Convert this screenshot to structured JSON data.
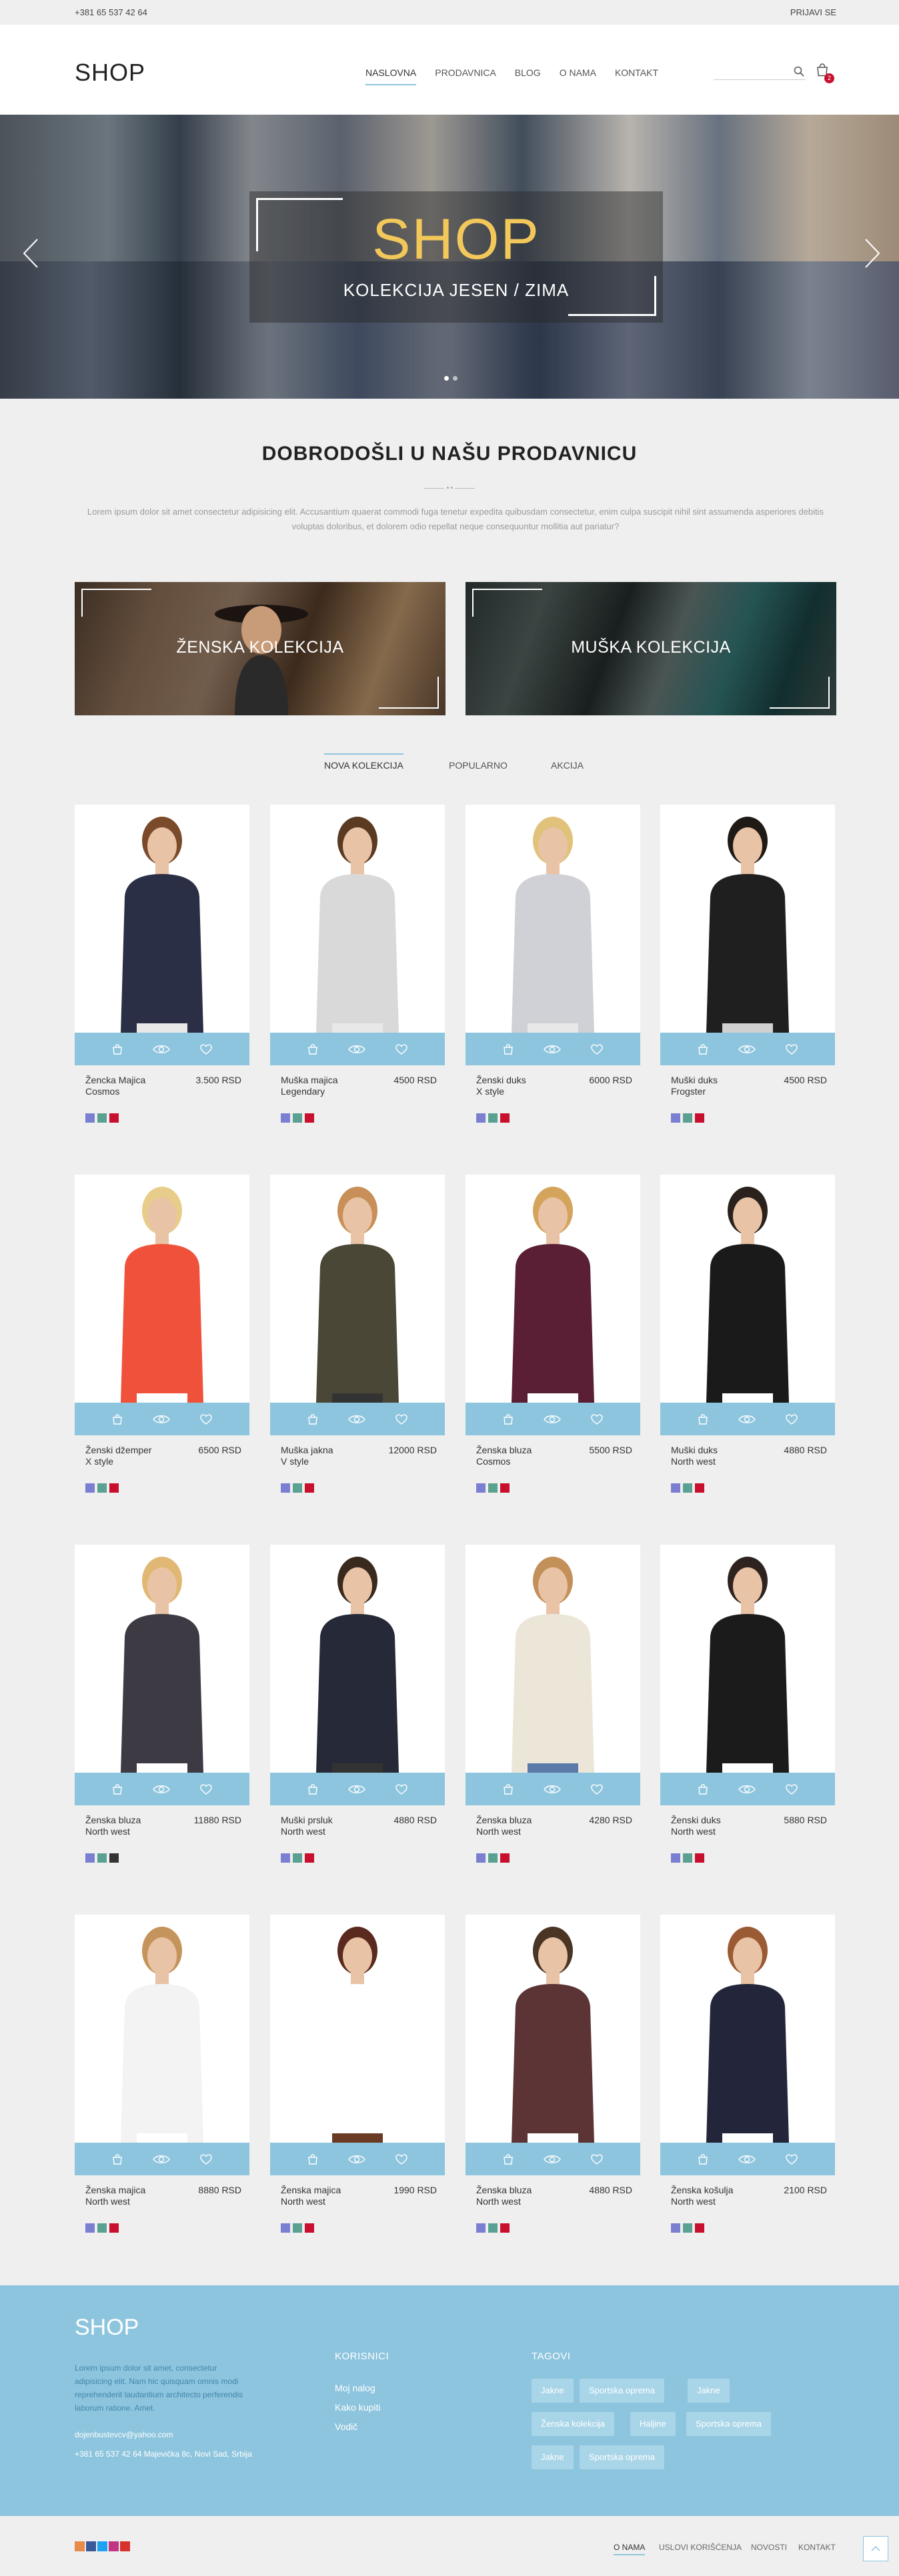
{
  "topbar": {
    "phone": "+381 65 537 42 64",
    "login": "PRIJAVI SE"
  },
  "header": {
    "logo": "SHOP",
    "nav": [
      "NASLOVNA",
      "PRODAVNICA",
      "BLOG",
      "O NAMA",
      "KONTAKT"
    ],
    "search_placeholder": "",
    "cart_count": "2"
  },
  "hero": {
    "title": "SHOP",
    "subtitle": "KOLEKCIJA JESEN / ZIMA"
  },
  "welcome": {
    "title": "DOBRODOŠLI U NAŠU PRODAVNICU",
    "text": "Lorem ipsum dolor sit amet consectetur adipisicing elit. Accusantium quaerat commodi fuga tenetur expedita quibusdam consectetur, enim culpa suscipit nihil sint assumenda asperiores debitis voluptas doloribus, et dolorem odio repellat neque consequuntur mollitia aut pariatur?"
  },
  "collections": {
    "women": "ŽENSKA KOLEKCIJA",
    "men": "MUŠKA KOLEKCIJA"
  },
  "tabs": [
    "NOVA KOLEKCIJA",
    "POPULARNO",
    "AKCIJA"
  ],
  "colors": {
    "accent": "#8ec5de",
    "swatch_violet": "#7b7fd1",
    "swatch_green": "#5aa191",
    "swatch_red": "#c8102e",
    "swatch_dark": "#333333"
  },
  "products": [
    {
      "name1": "Žencka Majica",
      "name2": "Cosmos",
      "price": "3.500 RSD"
    },
    {
      "name1": "Muška majica",
      "name2": "Legendary",
      "price": "4500 RSD"
    },
    {
      "name1": "Ženski duks",
      "name2": "X style",
      "price": "6000 RSD"
    },
    {
      "name1": "Muški duks",
      "name2": "Frogster",
      "price": "4500 RSD"
    },
    {
      "name1": "Ženski džemper",
      "name2": "X style",
      "price": "6500 RSD"
    },
    {
      "name1": "Muška jakna",
      "name2": "V style",
      "price": "12000 RSD"
    },
    {
      "name1": "Ženska bluza",
      "name2": "Cosmos",
      "price": "5500 RSD"
    },
    {
      "name1": "Muški duks",
      "name2": "North west",
      "price": "4880 RSD"
    },
    {
      "name1": "Ženska bluza",
      "name2": "North west",
      "price": "11880 RSD"
    },
    {
      "name1": "Muški prsluk",
      "name2": "North west",
      "price": "4880 RSD"
    },
    {
      "name1": "Ženska bluza",
      "name2": "North west",
      "price": "4280 RSD"
    },
    {
      "name1": "Ženski duks",
      "name2": "North west",
      "price": "5880 RSD"
    },
    {
      "name1": "Ženska majica",
      "name2": "North west",
      "price": "8880 RSD"
    },
    {
      "name1": "Ženska majica",
      "name2": "North west",
      "price": "1990 RSD"
    },
    {
      "name1": "Ženska bluza",
      "name2": "North west",
      "price": "4880 RSD"
    },
    {
      "name1": "Ženska košulja",
      "name2": "North west",
      "price": "2100 RSD"
    }
  ],
  "footer": {
    "logo": "SHOP",
    "desc": "Lorem ipsum dolor sit amet, consectetur adipisicing elit. Nam hic quisquam omnis modi reprehenderit laudantium architecto perferendis laborum ratione. Amet.",
    "email": "dojenbustevcv@yahoo.com",
    "address": "+381 65 537 42 64 Majevička 8c, Novi Sad, Srbija",
    "users_title": "KORISNICI",
    "users_links": [
      "Moj nalog",
      "Kako kupiti",
      "Vodič"
    ],
    "tags_title": "TAGOVI",
    "tags": [
      "Jakne",
      "Sportska oprema",
      "Jakne",
      "Ženska kolekcija",
      "Haljine",
      "Sportska oprema",
      "Jakne",
      "Sportska oprema"
    ]
  },
  "bottom": {
    "links": [
      "O NAMA",
      "USLOVI KORIŠĆENJA",
      "NOVOSTI",
      "KONTAKT"
    ]
  }
}
